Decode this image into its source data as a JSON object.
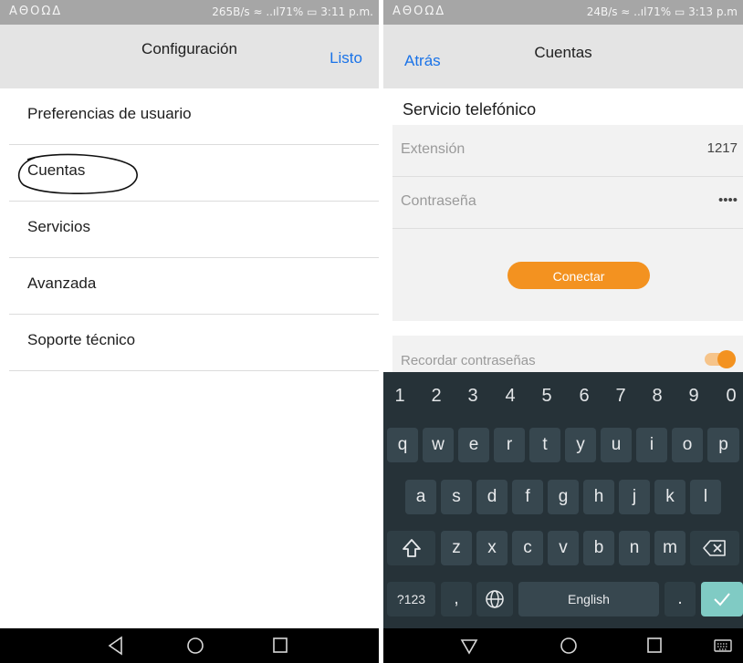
{
  "left": {
    "status_left": "ΑΘΟΩΔ",
    "status_right": "265B/s ≈ ..ıl71% ▭ 3:11 p.m.",
    "title": "Configuración",
    "done_label": "Listo",
    "items": [
      {
        "label": "Preferencias de usuario"
      },
      {
        "label": "Cuentas"
      },
      {
        "label": "Servicios"
      },
      {
        "label": "Avanzada"
      },
      {
        "label": "Soporte técnico"
      }
    ]
  },
  "right": {
    "status_left": "ΑΘΟΩΔ",
    "status_right": "24B/s ≈ ..ıl71% ▭ 3:13 p.m",
    "back_label": "Atrás",
    "title": "Cuentas",
    "section_title": "Servicio telefónico",
    "extension_label": "Extensión",
    "extension_value": "1217",
    "password_label": "Contraseña",
    "password_value": "••••",
    "connect_label": "Conectar",
    "remember_label": "Recordar contraseñas",
    "remember_on": true,
    "keyboard": {
      "numbers": [
        "1",
        "2",
        "3",
        "4",
        "5",
        "6",
        "7",
        "8",
        "9",
        "0"
      ],
      "row1": [
        "q",
        "w",
        "e",
        "r",
        "t",
        "y",
        "u",
        "i",
        "o",
        "p"
      ],
      "row2": [
        "a",
        "s",
        "d",
        "f",
        "g",
        "h",
        "j",
        "k",
        "l"
      ],
      "row3": [
        "z",
        "x",
        "c",
        "v",
        "b",
        "n",
        "m"
      ],
      "mode_key": "?123",
      "comma_key": ",",
      "space_label": "English",
      "period_key": ".",
      "shift_icon": "shift-icon",
      "backspace_icon": "backspace-icon",
      "globe_icon": "globe-icon",
      "enter_icon": "check-icon"
    }
  },
  "colors": {
    "accent_blue": "#1a73e8",
    "accent_orange": "#f39220",
    "keyboard_bg": "#263238",
    "enter_key": "#80cbc4"
  }
}
